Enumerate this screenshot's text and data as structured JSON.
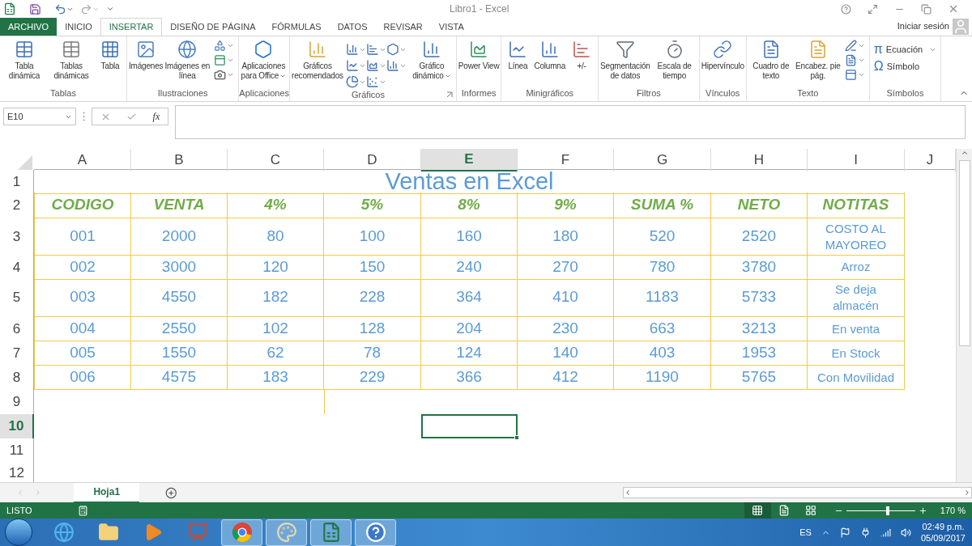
{
  "window": {
    "title": "Libro1 - Excel",
    "sign_in": "Iniciar sesión"
  },
  "tabs": [
    {
      "label": "ARCHIVO",
      "kind": "file",
      "selected": false
    },
    {
      "label": "INICIO",
      "kind": "tab",
      "selected": false
    },
    {
      "label": "INSERTAR",
      "kind": "tab",
      "selected": true
    },
    {
      "label": "DISEÑO DE PÁGINA",
      "kind": "tab",
      "selected": false
    },
    {
      "label": "FÓRMULAS",
      "kind": "tab",
      "selected": false
    },
    {
      "label": "DATOS",
      "kind": "tab",
      "selected": false
    },
    {
      "label": "REVISAR",
      "kind": "tab",
      "selected": false
    },
    {
      "label": "VISTA",
      "kind": "tab",
      "selected": false
    }
  ],
  "ribbon": [
    {
      "label": "Tablas",
      "launcher": false,
      "buttons": [
        {
          "kind": "pivot",
          "label": "Tabla dinámica",
          "dropdown": false
        },
        {
          "kind": "pivot-recommended",
          "label": "Tablas dinámicas",
          "dropdown": false
        },
        {
          "kind": "table",
          "label": "Tabla",
          "dropdown": false
        }
      ]
    },
    {
      "label": "Ilustraciones",
      "launcher": false,
      "buttons": [
        {
          "kind": "pictures",
          "label": "Imágenes",
          "dropdown": false
        },
        {
          "kind": "online-pictures",
          "label": "Imágenes en línea",
          "dropdown": false
        },
        {
          "kind": "illustration-tools"
        }
      ]
    },
    {
      "label": "Aplicaciones",
      "launcher": false,
      "buttons": [
        {
          "kind": "apps",
          "label": "Aplicaciones para Office",
          "dropdown": true
        }
      ]
    },
    {
      "label": "Gráficos",
      "launcher": true,
      "buttons": [
        {
          "kind": "recommended-charts",
          "label": "Gráficos recomendados",
          "dropdown": false
        },
        {
          "kind": "chart-types"
        },
        {
          "kind": "pivot-chart",
          "label": "Gráfico dinámico",
          "dropdown": true
        }
      ]
    },
    {
      "label": "Informes",
      "launcher": false,
      "buttons": [
        {
          "kind": "power-view",
          "label": "Power View",
          "dropdown": false
        }
      ]
    },
    {
      "label": "Minigráficos",
      "launcher": false,
      "buttons": [
        {
          "kind": "spark-line",
          "label": "Línea",
          "dropdown": false
        },
        {
          "kind": "spark-column",
          "label": "Columna",
          "dropdown": false
        },
        {
          "kind": "spark-winloss",
          "label": "+/-",
          "dropdown": false
        }
      ]
    },
    {
      "label": "Filtros",
      "launcher": false,
      "buttons": [
        {
          "kind": "slicer",
          "label": "Segmentación de datos",
          "dropdown": false
        },
        {
          "kind": "timeline",
          "label": "Escala de tiempo",
          "dropdown": false
        }
      ]
    },
    {
      "label": "Vínculos",
      "launcher": false,
      "buttons": [
        {
          "kind": "hyperlink",
          "label": "Hipervínculo",
          "dropdown": false
        }
      ]
    },
    {
      "label": "Texto",
      "launcher": false,
      "buttons": [
        {
          "kind": "textbox",
          "label": "Cuadro de texto",
          "dropdown": false
        },
        {
          "kind": "header-footer",
          "label": "Encabez. pie pág.",
          "dropdown": false
        },
        {
          "kind": "text-tools"
        }
      ]
    },
    {
      "label": "Símbolos",
      "launcher": false,
      "buttons": [
        {
          "kind": "symbols",
          "items": [
            {
              "symbol": "π",
              "label": "Ecuación",
              "dropdown": true
            },
            {
              "symbol": "Ω",
              "label": "Símbolo",
              "dropdown": false
            }
          ]
        }
      ]
    }
  ],
  "formula_bar": {
    "name_box": "E10",
    "function_label": "fx"
  },
  "sheet": {
    "columns": [
      {
        "letter": "A",
        "selected": false
      },
      {
        "letter": "B",
        "selected": false
      },
      {
        "letter": "C",
        "selected": false
      },
      {
        "letter": "D",
        "selected": false
      },
      {
        "letter": "E",
        "selected": true
      },
      {
        "letter": "F",
        "selected": false
      },
      {
        "letter": "G",
        "selected": false
      },
      {
        "letter": "H",
        "selected": false
      },
      {
        "letter": "I",
        "selected": false
      },
      {
        "letter": "J",
        "selected": false
      }
    ],
    "rows": [
      {
        "number": "1",
        "selected": false
      },
      {
        "number": "2",
        "selected": false
      },
      {
        "number": "3",
        "selected": false
      },
      {
        "number": "4",
        "selected": false
      },
      {
        "number": "5",
        "selected": false
      },
      {
        "number": "6",
        "selected": false
      },
      {
        "number": "7",
        "selected": false
      },
      {
        "number": "8",
        "selected": false
      },
      {
        "number": "9",
        "selected": false
      },
      {
        "number": "10",
        "selected": true
      },
      {
        "number": "11",
        "selected": false
      },
      {
        "number": "12",
        "selected": false
      }
    ],
    "title": "Ventas en Excel",
    "header": [
      "CODIGO",
      "VENTA",
      "4%",
      "5%",
      "8%",
      "9%",
      "SUMA %",
      "NETO",
      "NOTITAS"
    ],
    "data": [
      {
        "values": [
          "001",
          "2000",
          "80",
          "100",
          "160",
          "180",
          "520",
          "2520"
        ],
        "note": "COSTO AL MAYOREO"
      },
      {
        "values": [
          "002",
          "3000",
          "120",
          "150",
          "240",
          "270",
          "780",
          "3780"
        ],
        "note": "Arroz"
      },
      {
        "values": [
          "003",
          "4550",
          "182",
          "228",
          "364",
          "410",
          "1183",
          "5733"
        ],
        "note": "Se deja almacén"
      },
      {
        "values": [
          "004",
          "2550",
          "102",
          "128",
          "204",
          "230",
          "663",
          "3213"
        ],
        "note": "En venta"
      },
      {
        "values": [
          "005",
          "1550",
          "62",
          "78",
          "124",
          "140",
          "403",
          "1953"
        ],
        "note": "En Stock"
      },
      {
        "values": [
          "006",
          "4575",
          "183",
          "229",
          "366",
          "412",
          "1190",
          "5765"
        ],
        "note": "Con Movilidad"
      }
    ]
  },
  "sheet_tabs": [
    {
      "label": "Hoja1",
      "selected": true
    }
  ],
  "status_bar": {
    "status": "LISTO",
    "views": [
      {
        "kind": "normal",
        "selected": true
      },
      {
        "kind": "page-layout",
        "selected": false
      },
      {
        "kind": "page-break",
        "selected": false
      }
    ],
    "zoom": {
      "level": 0.6,
      "reading": "170 %"
    }
  },
  "taskbar": {
    "apps": [
      {
        "kind": "browser-e",
        "running": false
      },
      {
        "kind": "folder",
        "running": false
      },
      {
        "kind": "media",
        "running": false
      },
      {
        "kind": "presentation",
        "running": false
      },
      {
        "kind": "browser-wheel",
        "running": true
      },
      {
        "kind": "paint",
        "running": true
      },
      {
        "kind": "spreadsheet",
        "running": true
      },
      {
        "kind": "help",
        "running": true
      }
    ],
    "language": "ES",
    "time": "02:49 p.m.",
    "date": "05/09/2017"
  }
}
